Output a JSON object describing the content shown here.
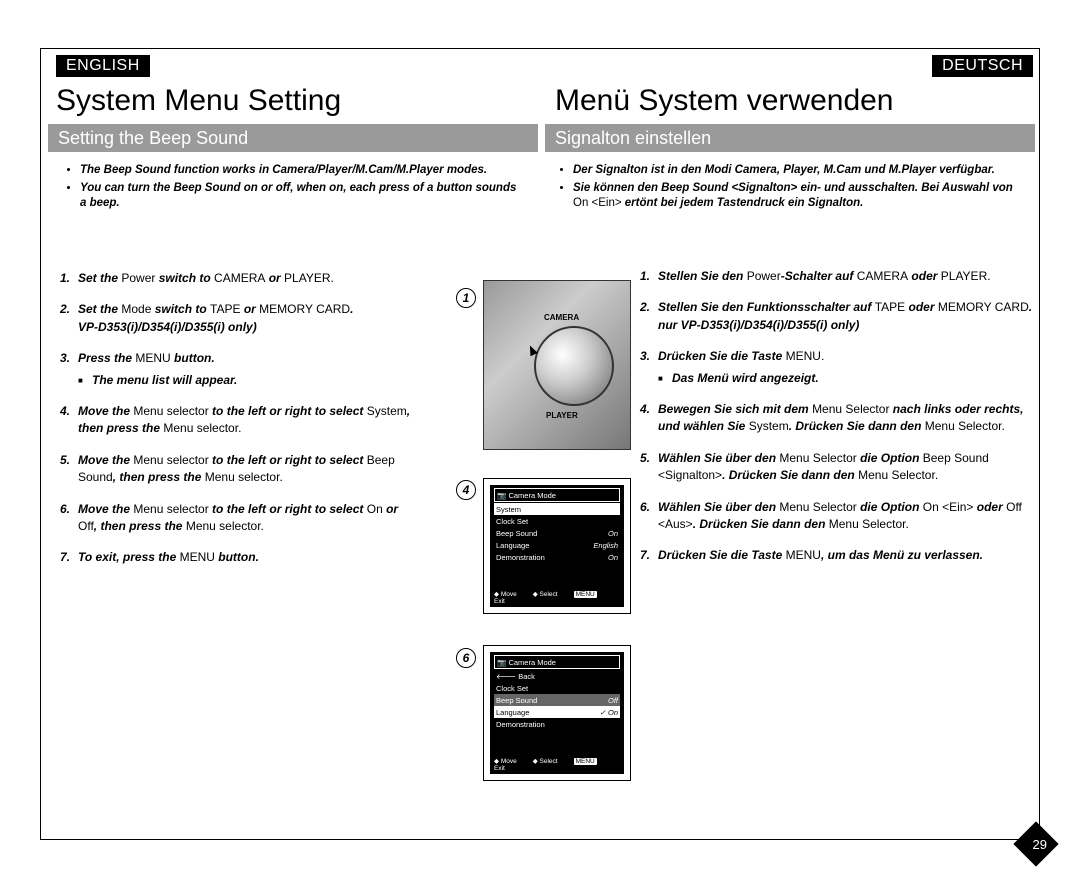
{
  "page_number": "29",
  "lang_labels": {
    "en": "ENGLISH",
    "de": "DEUTSCH"
  },
  "titles": {
    "en": "System Menu Setting",
    "de": "Menü System verwenden"
  },
  "sections": {
    "en": "Setting the Beep Sound",
    "de": "Signalton einstellen"
  },
  "intro_en": {
    "b1": "The Beep Sound function works in Camera/Player/M.Cam/M.Player modes.",
    "b2": "You can turn the Beep Sound on or off, when on, each press of a button sounds a beep."
  },
  "intro_de": {
    "b1": "Der Signalton ist in den Modi Camera, Player, M.Cam und M.Player verfügbar.",
    "b2a": "Sie können den Beep Sound <Signalton> ein- und ausschalten. Bei Auswahl von ",
    "b2b": "On <Ein>",
    "b2c": " ertönt bei jedem Tastendruck ein Signalton."
  },
  "steps_en": {
    "s1": {
      "a": "Set the ",
      "b": "Power",
      "c": " switch to ",
      "d": "CAMERA",
      "e": " or ",
      "f": "PLAYER",
      "g": "."
    },
    "s2": {
      "a": "Set the ",
      "b": "Mode",
      "c": " switch to ",
      "d": "TAPE",
      "e": " or ",
      "f": "MEMORY CARD",
      "g": ".",
      "h": "VP-D353(i)/D354(i)/D355(i) only)"
    },
    "s3": {
      "a": "Press the ",
      "b": "MENU",
      "c": " button.",
      "sub": "The menu list will appear."
    },
    "s4": {
      "a": "Move the ",
      "b": "Menu selector",
      "c": " to the left or right to select ",
      "d": "System",
      "e": ", then press the ",
      "f": "Menu selector",
      "g": "."
    },
    "s5": {
      "a": "Move the ",
      "b": "Menu selector",
      "c": " to the left or right to select ",
      "d": "Beep Sound",
      "e": ", then press the ",
      "f": "Menu selector",
      "g": "."
    },
    "s6": {
      "a": "Move the ",
      "b": "Menu selector",
      "c": " to the left or right to select ",
      "d": "On",
      "e": " or ",
      "f": "Off",
      "g": ", then press the ",
      "h": "Menu selector",
      "i": "."
    },
    "s7": {
      "a": "To exit, press the ",
      "b": "MENU",
      "c": " button."
    }
  },
  "steps_de": {
    "s1": {
      "a": "Stellen Sie den ",
      "b": "Power",
      "c": "-Schalter auf ",
      "d": "CAMERA",
      "e": " oder ",
      "f": "PLAYER",
      "g": "."
    },
    "s2": {
      "a": "Stellen Sie den Funktionsschalter auf ",
      "b": "TAPE",
      "c": " oder ",
      "d": "MEMORY CARD",
      "e": ". nur  VP-D353(i)/D354(i)/D355(i) only)"
    },
    "s3": {
      "a": "Drücken Sie die Taste ",
      "b": "MENU",
      "c": ".",
      "sub": "Das Menü wird angezeigt."
    },
    "s4": {
      "a": "Bewegen Sie sich mit dem ",
      "b": "Menu Selector",
      "c": " nach links oder rechts, und wählen Sie ",
      "d": "System",
      "e": ". Drücken Sie dann den ",
      "f": "Menu Selector",
      "g": "."
    },
    "s5": {
      "a": "Wählen Sie über den ",
      "b": "Menu Selector",
      "c": " die Option ",
      "d": "Beep Sound <Signalton>",
      "e": ". Drücken Sie dann den ",
      "f": "Menu Selector",
      "g": "."
    },
    "s6": {
      "a": "Wählen Sie über den ",
      "b": "Menu Selector",
      "c": " die Option ",
      "d": "On <Ein>",
      "e": " oder ",
      "f": "Off <Aus>",
      "g": ". Drücken Sie dann den ",
      "h": "Menu Selector",
      "i": "."
    },
    "s7": {
      "a": "Drücken Sie die Taste ",
      "b": "MENU",
      "c": ", um das Menü zu verlassen."
    }
  },
  "dial": {
    "camera": "CAMERA",
    "player": "PLAYER"
  },
  "osd4": {
    "title": "Camera Mode",
    "rows": [
      {
        "label": "System",
        "val": ""
      },
      {
        "label": "Clock Set",
        "val": ""
      },
      {
        "label": "Beep Sound",
        "val": "On"
      },
      {
        "label": "Language",
        "val": "English"
      },
      {
        "label": "Demonstration",
        "val": "On"
      }
    ],
    "foot": {
      "move": "Move",
      "select": "Select",
      "exit": "Exit",
      "menu": "MENU"
    }
  },
  "osd6": {
    "title": "Camera Mode",
    "back": "Back",
    "rows": [
      {
        "label": "Clock Set",
        "val": ""
      },
      {
        "label": "Beep Sound",
        "val": "Off"
      },
      {
        "label": "Language",
        "val": "✓ On"
      },
      {
        "label": "Demonstration",
        "val": ""
      }
    ],
    "foot": {
      "move": "Move",
      "select": "Select",
      "exit": "Exit",
      "menu": "MENU"
    }
  },
  "badges": {
    "b1": "1",
    "b4": "4",
    "b6": "6"
  }
}
